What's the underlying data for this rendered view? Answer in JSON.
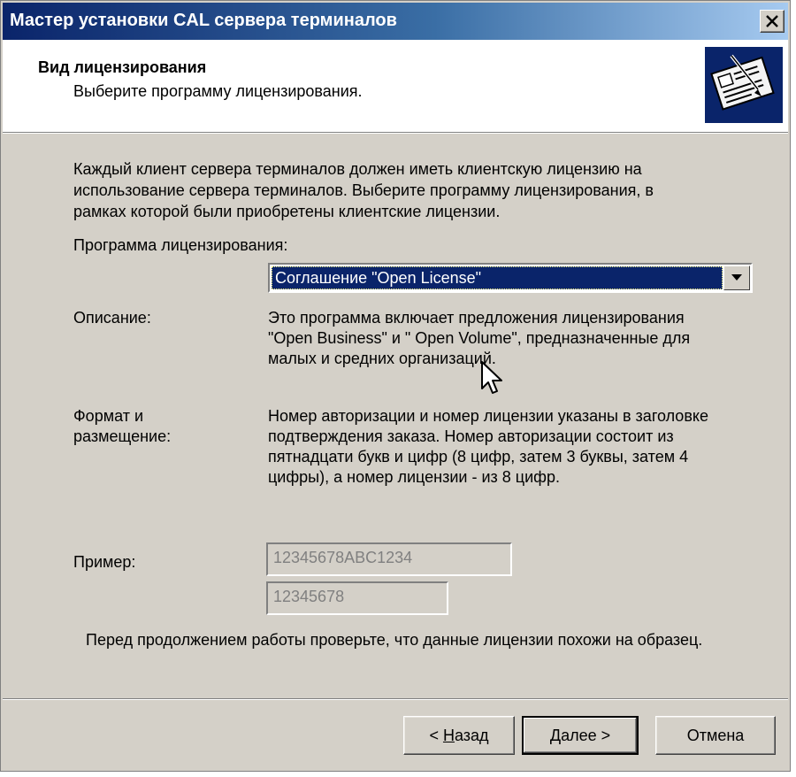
{
  "window": {
    "title": "Мастер установки CAL сервера терминалов"
  },
  "header": {
    "title": "Вид лицензирования",
    "subtitle": "Выберите программу лицензирования.",
    "icon": "license-certificate-icon"
  },
  "main": {
    "intro": [
      "Каждый клиент сервера терминалов должен иметь клиентскую лицензию на",
      "использование сервера терминалов. Выберите программу лицензирования, в",
      "рамках которой были приобретены клиентские лицензии."
    ],
    "program_label": "Программа лицензирования:",
    "program_value": "Соглашение \"Open License\"",
    "description_label": "Описание:",
    "description_lines": [
      "Это программа включает предложения лицензирования",
      "\"Open Business\" и \" Open Volume\", предназначенные для",
      "малых и средних организаций."
    ],
    "format_label_lines": [
      "Формат и",
      "размещение:"
    ],
    "format_lines": [
      "Номер авторизации и номер лицензии указаны в заголовке",
      "подтверждения заказа.  Номер авторизации состоит из",
      "пятнадцати букв и цифр (8 цифр, затем 3 буквы, затем 4",
      "цифры), а номер лицензии - из 8 цифр."
    ],
    "example_label": "Пример:",
    "example_auth": "12345678ABC1234",
    "example_license": "12345678",
    "note": "Перед продолжением работы проверьте, что данные лицензии похожи на образец."
  },
  "buttons": {
    "back_prefix": "< ",
    "back_underlined": "Н",
    "back_rest": "азад",
    "next_underlined": "Д",
    "next_rest": "алее >",
    "cancel": "Отмена"
  }
}
